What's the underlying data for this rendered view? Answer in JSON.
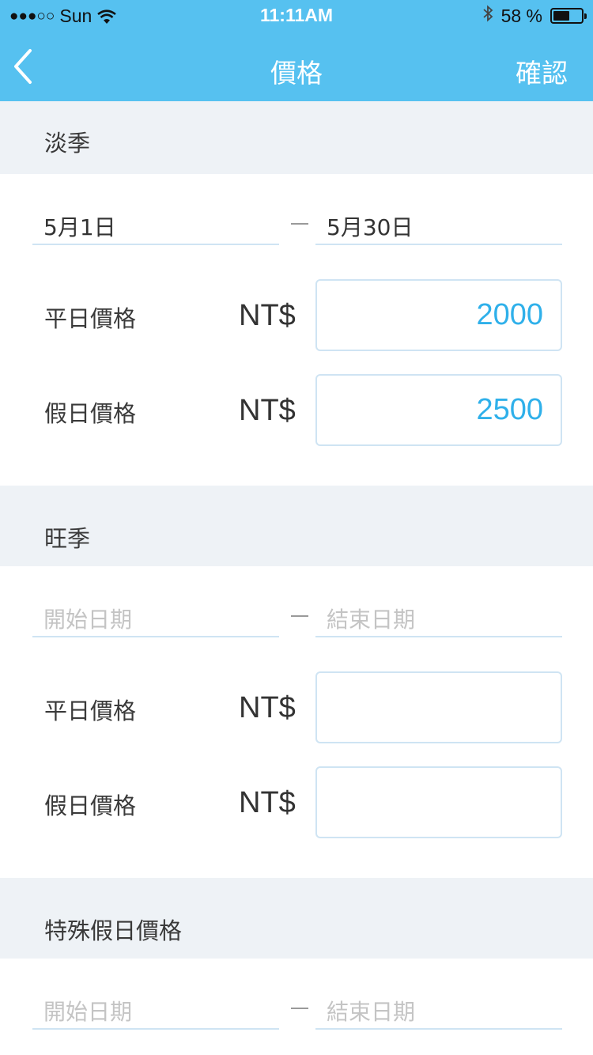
{
  "status_bar": {
    "signal_dots": "●●●○○",
    "carrier": "Sun",
    "time": "11:11AM",
    "bluetooth": "bluetooth-icon",
    "battery_text": "58 %",
    "battery_level": 0.58
  },
  "nav": {
    "title": "價格",
    "confirm": "確認",
    "back_icon": "chevron-left-icon"
  },
  "colors": {
    "header_bg": "#56c1f0",
    "section_bg": "#eef2f6",
    "value_blue": "#2fb0ea",
    "field_border": "#cfe4f3"
  },
  "sections": [
    {
      "title": "淡季",
      "start_date": "5月1日",
      "end_date": "5月30日",
      "weekday_label": "平日價格",
      "holiday_label": "假日價格",
      "currency": "NT$",
      "weekday_price": "2000",
      "holiday_price": "2500"
    },
    {
      "title": "旺季",
      "start_placeholder": "開始日期",
      "end_placeholder": "結束日期",
      "weekday_label": "平日價格",
      "holiday_label": "假日價格",
      "currency": "NT$",
      "weekday_price": "",
      "holiday_price": ""
    },
    {
      "title": "特殊假日價格",
      "start_placeholder": "開始日期",
      "end_placeholder": "結束日期"
    }
  ]
}
